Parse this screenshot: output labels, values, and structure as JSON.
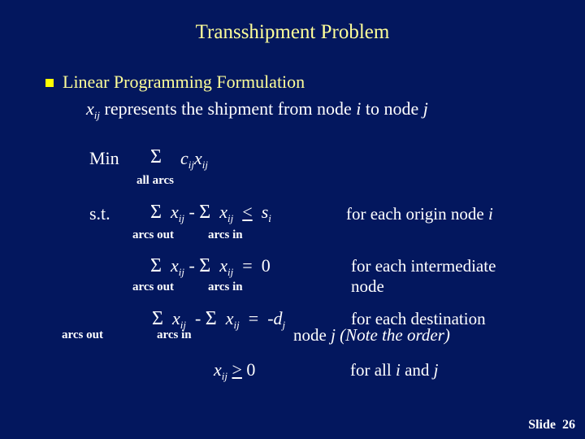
{
  "title": "Transshipment Problem",
  "bullet": {
    "icon": "square-bullet-icon",
    "heading": "Linear Programming Formulation",
    "line2": {
      "var": "x",
      "sub": "ij",
      "text_a": " represents the shipment from node ",
      "i": "i",
      "text_b": " to node ",
      "j": "j"
    }
  },
  "objective": {
    "label": "Min",
    "sigma": "Σ",
    "c": "c",
    "c_sub": "ij",
    "x": "x",
    "x_sub": "ij",
    "under": "all arcs"
  },
  "constraints": {
    "st_label": "s.t.",
    "origin": {
      "sigma1": "Σ",
      "x1": "x",
      "x1_sub": "ij",
      "minus": "-",
      "sigma2": "Σ",
      "x2": "x",
      "x2_sub": "ij",
      "op": "<",
      "rhs": "s",
      "rhs_sub": "i",
      "under1": "arcs out",
      "under2": "arcs in",
      "note": "for each origin node ",
      "note_var": "i"
    },
    "intermediate": {
      "sigma1": "Σ",
      "x1": "x",
      "x1_sub": "ij",
      "minus": "-",
      "sigma2": "Σ",
      "x2": "x",
      "x2_sub": "ij",
      "op": "=",
      "rhs": "0",
      "under1": "arcs out",
      "under2": "arcs in",
      "note_line1": "for each intermediate",
      "note_line2": "node"
    },
    "destination": {
      "sigma1": "Σ",
      "x1": "x",
      "x1_sub": "ij",
      "minus": "-",
      "sigma2": "Σ",
      "x2": "x",
      "x2_sub": "ij",
      "op": "=",
      "rhs": "-d",
      "rhs_sub": "j",
      "under_left": "arcs out",
      "under_mid": "arcs in",
      "note_line1": "for each destination",
      "note_line2_a": "node ",
      "note_line2_var": "j",
      "note_line2_b": " (Note the order)"
    },
    "nonneg": {
      "x": "x",
      "x_sub": "ij",
      "op": ">",
      "rhs": "0",
      "note_a": "for all ",
      "i": "i",
      "note_b": " and ",
      "j": "j"
    }
  },
  "footer": {
    "slide_label": "Slide",
    "slide_number": "26"
  }
}
